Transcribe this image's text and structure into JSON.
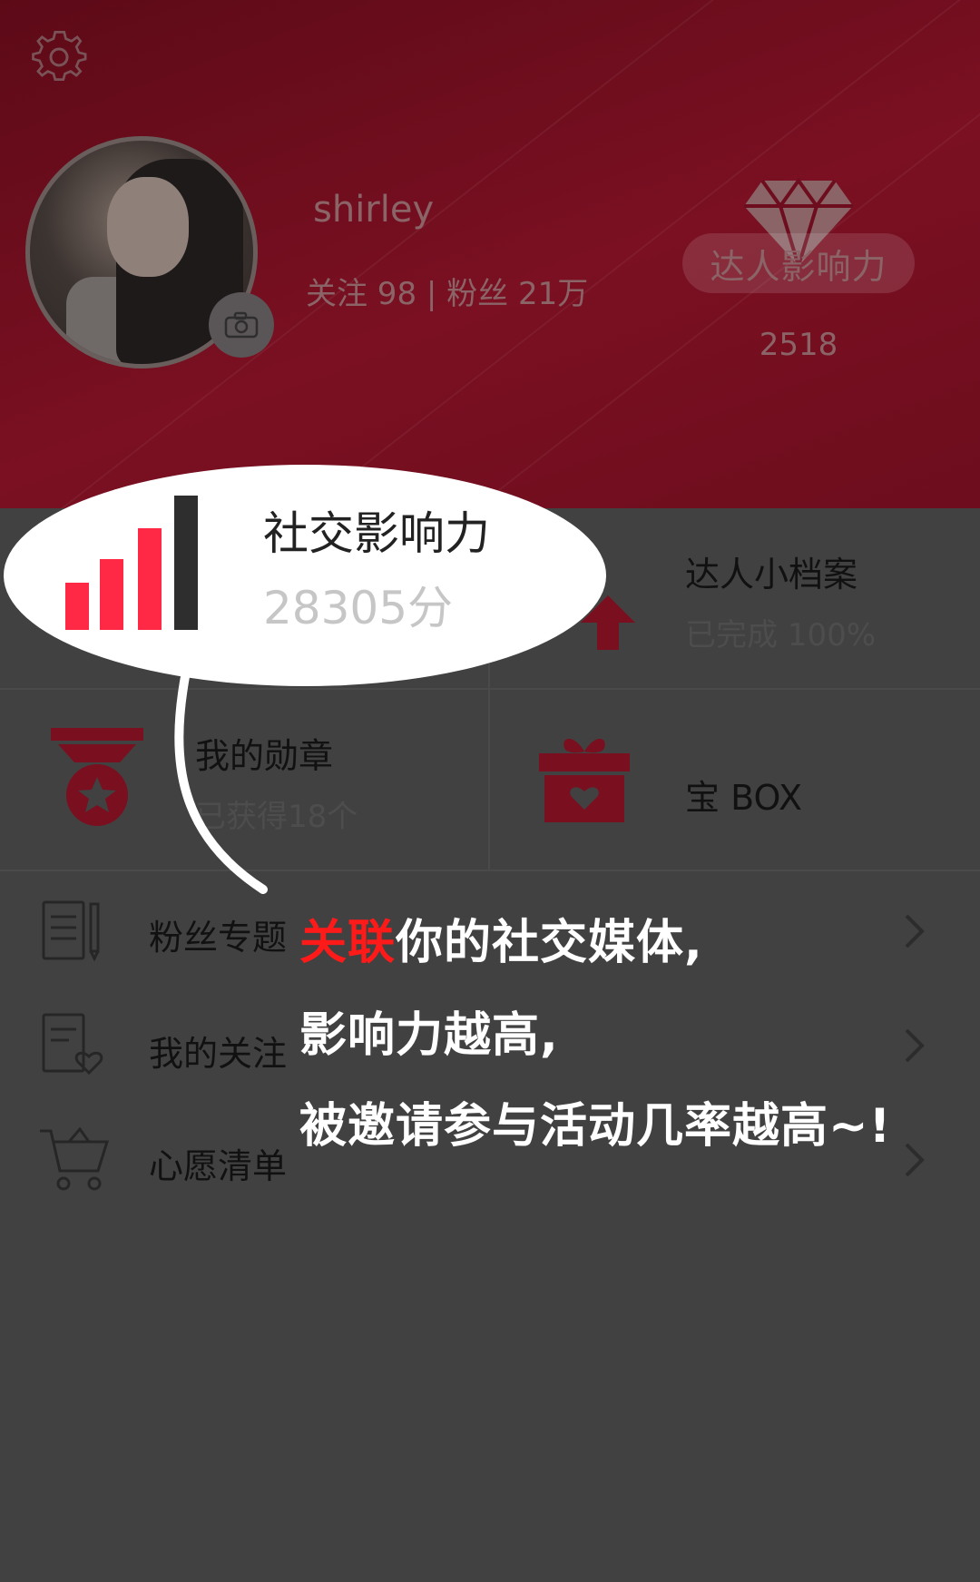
{
  "profile": {
    "username": "shirley",
    "stats_text": "关注 98 | 粉丝 21万",
    "badge_label": "达人影响力",
    "badge_score": "2518"
  },
  "grid": [
    {
      "title": "社交影响力",
      "subtitle": "28305分"
    },
    {
      "title": "达人小档案",
      "subtitle": "已完成 100%"
    },
    {
      "title": "我的勋章",
      "subtitle": "已获得18个"
    },
    {
      "title": "宝 BOX",
      "subtitle": ""
    }
  ],
  "menu": [
    {
      "label": "粉丝专题"
    },
    {
      "label": "我的关注"
    },
    {
      "label": "心愿清单"
    }
  ],
  "callout": {
    "title": "社交影响力",
    "score": "28305分",
    "line1_highlight": "关联",
    "line1_rest": "你的社交媒体,",
    "line2": "影响力越高,",
    "line3": "被邀请参与活动几率越高~!"
  },
  "colors": {
    "header_bg": "#6d0d1d",
    "accent_red": "#ff2945",
    "icon_red_dim": "#7a0f1f",
    "overlay_bg": "#414141",
    "caption_highlight": "#ff1a1a"
  },
  "icons": [
    "settings-gear-icon",
    "camera-icon",
    "diamond-icon",
    "signal-bars-icon",
    "medal-icon",
    "gift-icon",
    "document-icon",
    "heart-note-icon",
    "cart-icon",
    "chevron-right-icon"
  ]
}
